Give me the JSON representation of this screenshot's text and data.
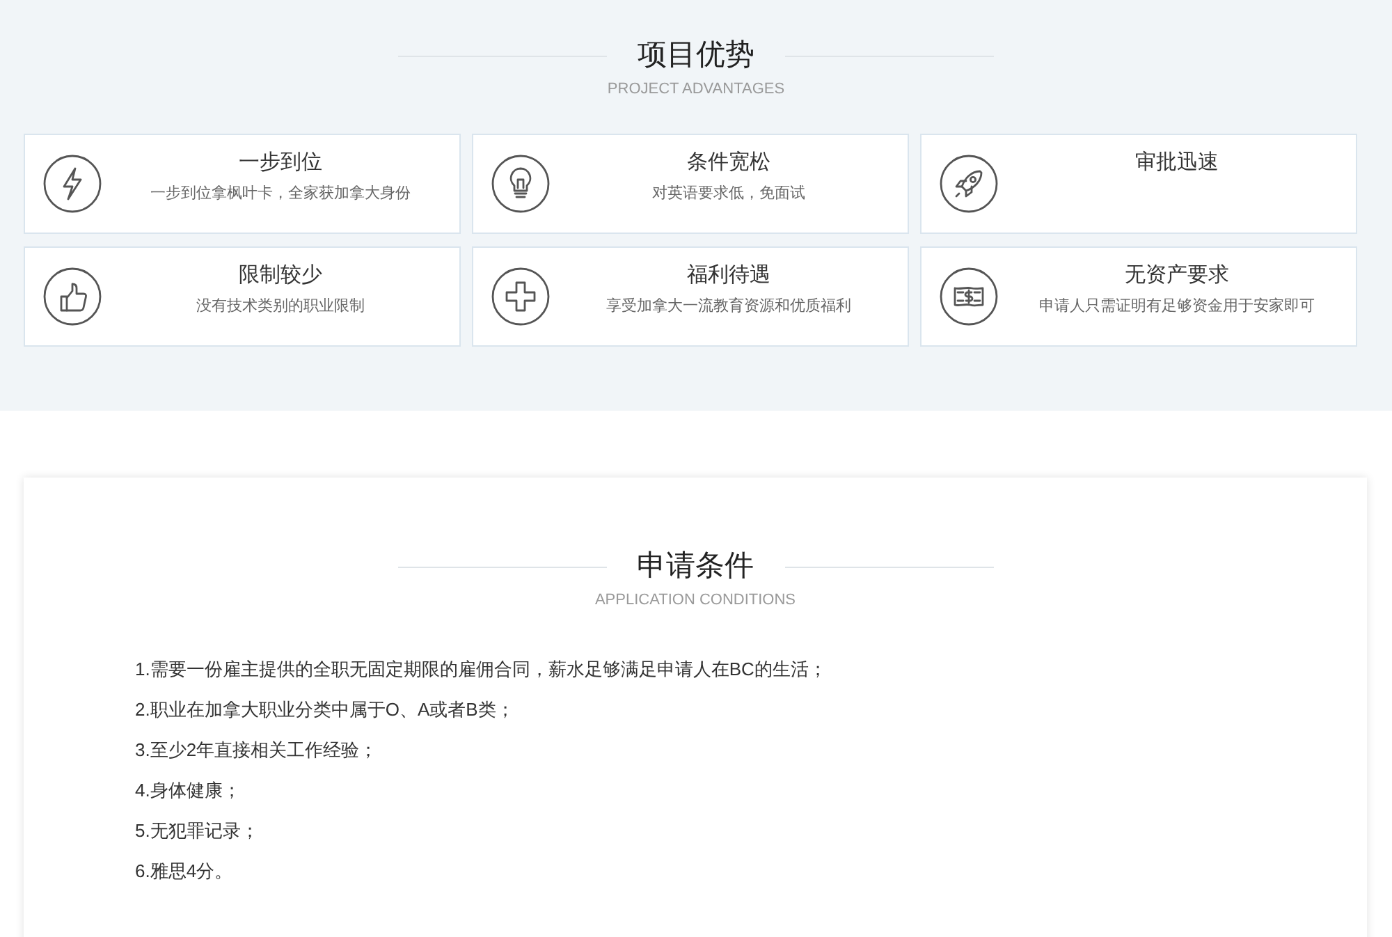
{
  "advantages_section": {
    "title": "项目优势",
    "subtitle": "PROJECT ADVANTAGES",
    "cards": [
      {
        "kind": "bolt",
        "title": "一步到位",
        "description": "一步到位拿枫叶卡，全家获加拿大身份"
      },
      {
        "kind": "bulb",
        "title": "条件宽松",
        "description": "对英语要求低，免面试"
      },
      {
        "kind": "rocket",
        "title": "审批迅速"
      },
      {
        "kind": "thumb",
        "title": "限制较少",
        "description": "没有技术类别的职业限制"
      },
      {
        "kind": "plus",
        "title": "福利待遇",
        "description": "享受加拿大一流教育资源和优质福利"
      },
      {
        "kind": "money",
        "title": "无资产要求",
        "description": "申请人只需证明有足够资金用于安家即可"
      }
    ]
  },
  "conditions_section": {
    "title": "申请条件",
    "subtitle": "APPLICATION CONDITIONS",
    "items": [
      "1.需要一份雇主提供的全职无固定期限的雇佣合同，薪水足够满足申请人在BC的生活；",
      "2.职业在加拿大职业分类中属于O、A或者B类；",
      "3.至少2年直接相关工作经验；",
      "4.身体健康；",
      "5.无犯罪记录；",
      "6.雅思4分。"
    ]
  }
}
